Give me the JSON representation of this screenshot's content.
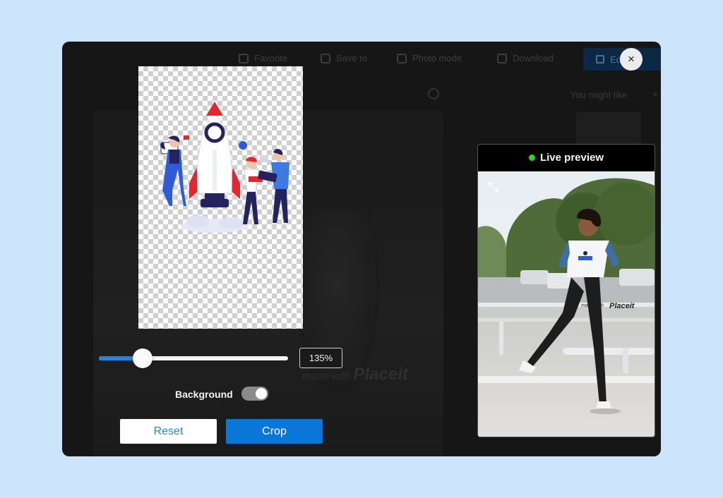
{
  "background_page": {
    "toolbar": {
      "favorite_label": "Favorite",
      "save_label": "Save to",
      "item3_label": "Photo mode",
      "item4_label": "Download",
      "primary_label": "Edit"
    },
    "sidebar_title": "You might like",
    "sidebar_close": "×",
    "shirt_text_small": "made with",
    "shirt_text_brand": "Placeit"
  },
  "editor": {
    "zoom_value": "135%",
    "zoom_fraction": 0.23,
    "background_label": "Background",
    "background_enabled": true,
    "reset_label": "Reset",
    "crop_label": "Crop"
  },
  "preview": {
    "title": "Live preview",
    "shirt_text_small": "made with",
    "shirt_text_brand": "Placeit"
  },
  "close_label": "×",
  "icons": {
    "close": "close-icon",
    "expand": "expand-icon",
    "live": "live-dot-icon"
  },
  "colors": {
    "accent": "#0a76d8",
    "slider_fill": "#1f86e5",
    "live_dot": "#2bd52b",
    "page_bg": "#cde5fb",
    "modal_bg": "#161616"
  }
}
